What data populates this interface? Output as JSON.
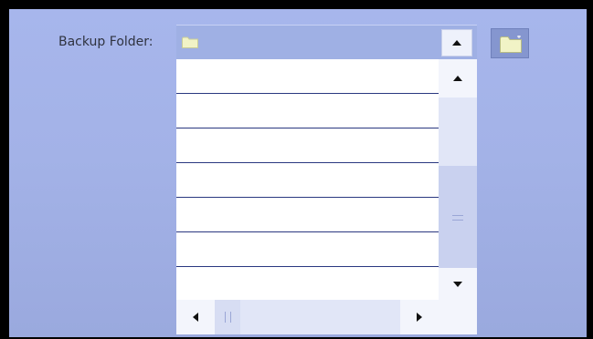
{
  "backup": {
    "label": "Backup Folder:",
    "selected_folder": ""
  },
  "folder_list": {
    "rows": [
      "",
      "",
      "",
      "",
      "",
      "",
      ""
    ]
  },
  "icons": {
    "combo_folder": "folder-icon",
    "browse": "folder-browse-icon",
    "combo_dropdown": "triangle-up-icon",
    "scroll_up": "triangle-up-icon",
    "scroll_down": "triangle-down-icon",
    "scroll_left": "triangle-left-icon",
    "scroll_right": "triangle-right-icon"
  },
  "colors": {
    "screen_background": "#a3b2e7",
    "list_background": "#ffffff",
    "row_divider": "#2a3880",
    "folder_fill": "#f1f3c6",
    "browse_button": "#8596cf"
  }
}
